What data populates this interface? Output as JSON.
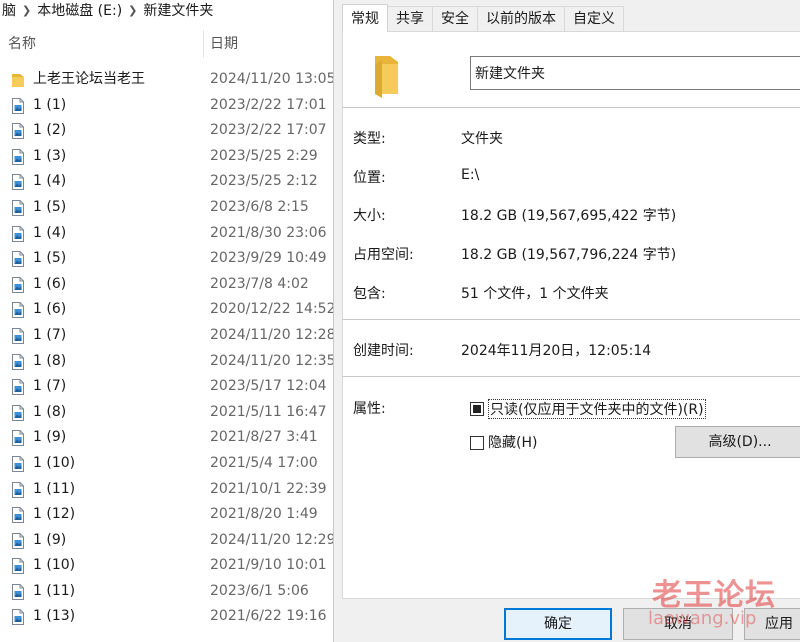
{
  "explorer": {
    "breadcrumb": [
      "脑",
      "本地磁盘 (E:)",
      "新建文件夹"
    ],
    "columns": {
      "name": "名称",
      "date": "日期"
    },
    "files": [
      {
        "name": "上老王论坛当老王",
        "date": "2024/11/20 13:05",
        "type": "folder"
      },
      {
        "name": "1 (1)",
        "date": "2023/2/22 17:01",
        "type": "file"
      },
      {
        "name": "1 (2)",
        "date": "2023/2/22 17:07",
        "type": "file"
      },
      {
        "name": "1 (3)",
        "date": "2023/5/25 2:29",
        "type": "file"
      },
      {
        "name": "1 (4)",
        "date": "2023/5/25 2:12",
        "type": "file"
      },
      {
        "name": "1 (5)",
        "date": "2023/6/8 2:15",
        "type": "file"
      },
      {
        "name": "1 (4)",
        "date": "2021/8/30 23:06",
        "type": "file"
      },
      {
        "name": "1 (5)",
        "date": "2023/9/29 10:49",
        "type": "file"
      },
      {
        "name": "1 (6)",
        "date": "2023/7/8 4:02",
        "type": "file"
      },
      {
        "name": "1 (6)",
        "date": "2020/12/22 14:52",
        "type": "file"
      },
      {
        "name": "1 (7)",
        "date": "2024/11/20 12:28",
        "type": "file"
      },
      {
        "name": "1 (8)",
        "date": "2024/11/20 12:35",
        "type": "file"
      },
      {
        "name": "1 (7)",
        "date": "2023/5/17 12:04",
        "type": "file"
      },
      {
        "name": "1 (8)",
        "date": "2021/5/11 16:47",
        "type": "file"
      },
      {
        "name": "1 (9)",
        "date": "2021/8/27 3:41",
        "type": "file"
      },
      {
        "name": "1 (10)",
        "date": "2021/5/4 17:00",
        "type": "file"
      },
      {
        "name": "1 (11)",
        "date": "2021/10/1 22:39",
        "type": "file"
      },
      {
        "name": "1 (12)",
        "date": "2021/8/20 1:49",
        "type": "file"
      },
      {
        "name": "1 (9)",
        "date": "2024/11/20 12:29",
        "type": "file"
      },
      {
        "name": "1 (10)",
        "date": "2021/9/10 10:01",
        "type": "file"
      },
      {
        "name": "1 (11)",
        "date": "2023/6/1 5:06",
        "type": "file"
      },
      {
        "name": "1 (13)",
        "date": "2021/6/22 19:16",
        "type": "file"
      }
    ]
  },
  "dialog": {
    "tabs": [
      "常规",
      "共享",
      "安全",
      "以前的版本",
      "自定义"
    ],
    "active_tab": 0,
    "folder_name": "新建文件夹",
    "props": {
      "type_label": "类型:",
      "type_value": "文件夹",
      "location_label": "位置:",
      "location_value": "E:\\",
      "size_label": "大小:",
      "size_value": "18.2 GB (19,567,695,422 字节)",
      "disk_size_label": "占用空间:",
      "disk_size_value": "18.2 GB (19,567,796,224 字节)",
      "contains_label": "包含:",
      "contains_value": "51 个文件，1 个文件夹",
      "created_label": "创建时间:",
      "created_value": "2024年11月20日，12:05:14",
      "attributes_label": "属性:"
    },
    "readonly_label": "只读(仅应用于文件夹中的文件)(R)",
    "readonly_checked": "indeterminate",
    "hidden_label": "隐藏(H)",
    "hidden_checked": false,
    "advanced_label": "高级(D)...",
    "ok_label": "确定",
    "cancel_label": "取消",
    "apply_label": "应用"
  },
  "watermark": {
    "main": "老王论坛",
    "sub": "laowang.vip"
  },
  "colors": {
    "accent": "#0078d7",
    "folder": "#f0c24a",
    "watermark": "#e03a3a"
  }
}
